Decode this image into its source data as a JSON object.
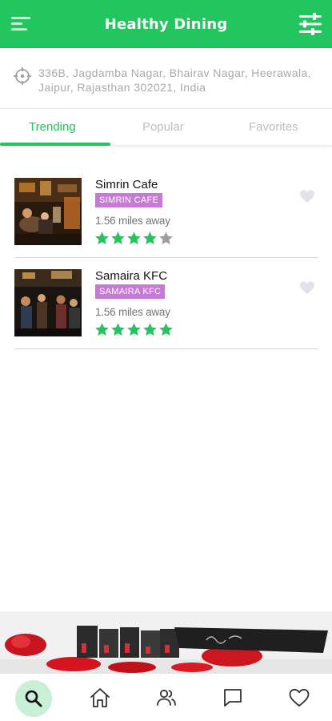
{
  "header": {
    "title": "Healthy Dining",
    "menu_icon": "menu-icon",
    "filter_icon": "filter-icon"
  },
  "location": {
    "icon": "location-crosshair-icon",
    "address": "336B, Jagdamba Nagar, Bhairav Nagar, Heerawala, Jaipur, Rajasthan 302021, India"
  },
  "tabs": [
    {
      "label": "Trending",
      "active": true
    },
    {
      "label": "Popular",
      "active": false
    },
    {
      "label": "Favorites",
      "active": false
    }
  ],
  "restaurants": [
    {
      "name": "Simrin Cafe",
      "badge": "SIMRIN CAFE",
      "distance": "1.56 miles away",
      "rating": 4,
      "max_rating": 5
    },
    {
      "name": "Samaira KFC",
      "badge": "SAMAIRA KFC",
      "distance": "1.56 miles away",
      "rating": 5,
      "max_rating": 5
    }
  ],
  "bottom_nav": [
    {
      "icon": "search-icon",
      "active": true
    },
    {
      "icon": "home-icon",
      "active": false
    },
    {
      "icon": "users-icon",
      "active": false
    },
    {
      "icon": "chat-icon",
      "active": false
    },
    {
      "icon": "heart-icon",
      "active": false
    }
  ],
  "colors": {
    "brand_green": "#22c55e",
    "badge_purple": "#c779d6",
    "star_filled": "#22c55e",
    "star_empty": "#9e9e9e",
    "active_nav_bg": "#c9f0d6"
  }
}
